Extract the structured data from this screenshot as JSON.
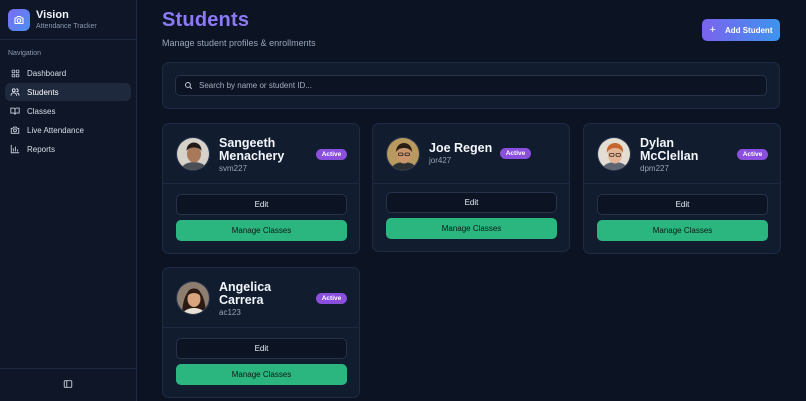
{
  "app": {
    "title": "Vision",
    "subtitle": "Attendance Tracker"
  },
  "sidebar": {
    "heading": "Navigation",
    "items": [
      {
        "label": "Dashboard",
        "icon": "dashboard-grid-icon",
        "active": false
      },
      {
        "label": "Students",
        "icon": "users-icon",
        "active": true
      },
      {
        "label": "Classes",
        "icon": "book-icon",
        "active": false
      },
      {
        "label": "Live Attendance",
        "icon": "camera-icon",
        "active": false
      },
      {
        "label": "Reports",
        "icon": "bar-chart-icon",
        "active": false
      }
    ],
    "footer_icon": "sidebar-toggle-icon"
  },
  "page": {
    "title": "Students",
    "subtitle": "Manage student profiles & enrollments",
    "add_button": "Add Student"
  },
  "search": {
    "placeholder": "Search by name or student ID..."
  },
  "students": [
    {
      "name": "Sangeeth Menachery",
      "id": "svm227",
      "status": "Active",
      "edit_label": "Edit",
      "manage_label": "Manage Classes"
    },
    {
      "name": "Joe Regen",
      "id": "jor427",
      "status": "Active",
      "edit_label": "Edit",
      "manage_label": "Manage Classes"
    },
    {
      "name": "Dylan McClellan",
      "id": "dpm227",
      "status": "Active",
      "edit_label": "Edit",
      "manage_label": "Manage Classes"
    },
    {
      "name": "Angelica Carrera",
      "id": "ac123",
      "status": "Active",
      "edit_label": "Edit",
      "manage_label": "Manage Classes"
    }
  ],
  "colors": {
    "accent": "#8d7af7",
    "badge": "#8a4fdf",
    "manage": "#2bb67f",
    "background": "#0c1424"
  }
}
